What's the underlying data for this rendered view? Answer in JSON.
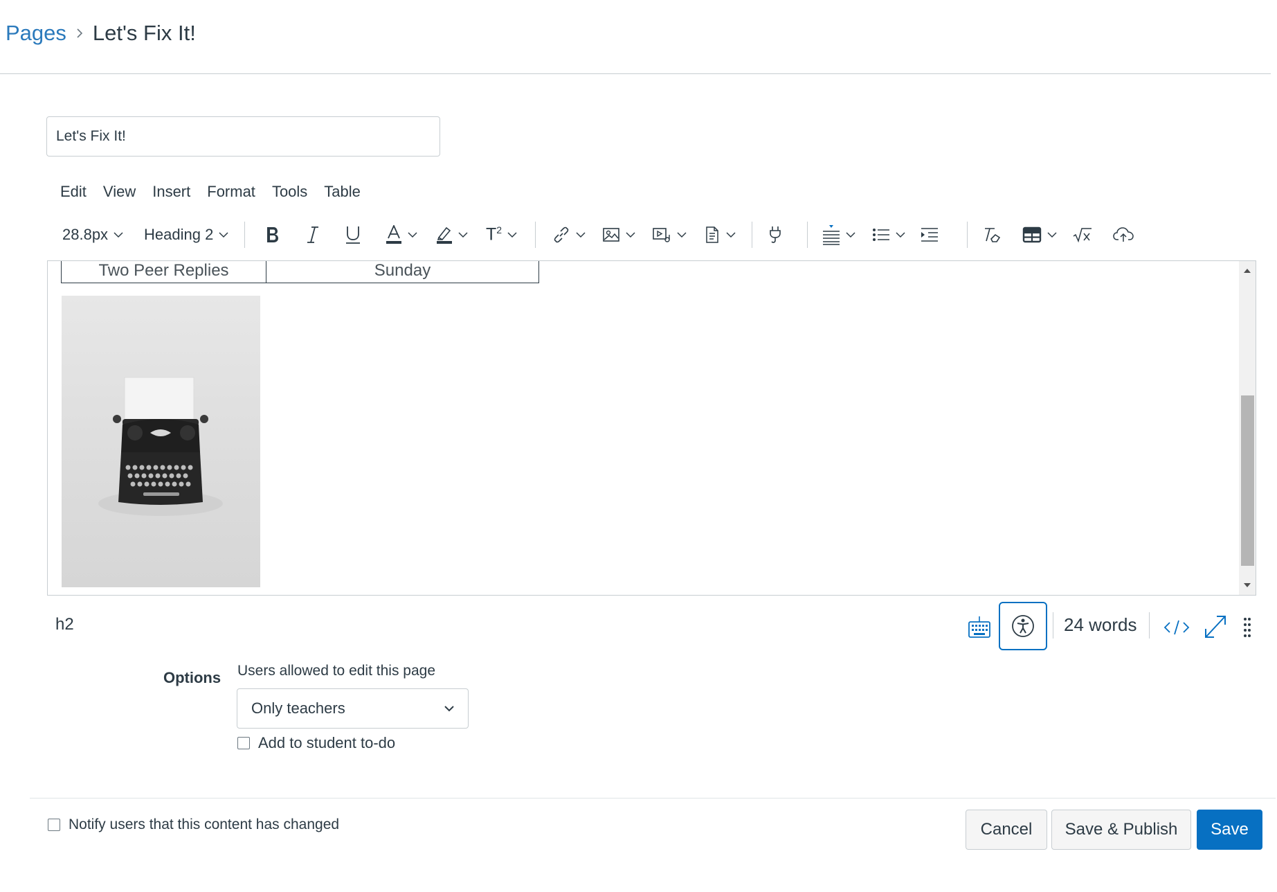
{
  "breadcrumb": {
    "parent": "Pages",
    "current": "Let's Fix It!"
  },
  "title_input": {
    "value": "Let's Fix It!"
  },
  "menubar": [
    "Edit",
    "View",
    "Insert",
    "Format",
    "Tools",
    "Table"
  ],
  "toolbar": {
    "font_size": "28.8px",
    "block_format": "Heading 2",
    "superscript_glyph": "T",
    "superscript_sup": "2"
  },
  "editor_content": {
    "table_row": [
      "Two Peer Replies",
      "Sunday"
    ],
    "image_subject": "typewriter"
  },
  "statusbar": {
    "element_path": "h2",
    "word_count": "24 words"
  },
  "options": {
    "label": "Options",
    "edit_permission_label": "Users allowed to edit this page",
    "edit_permission_value": "Only teachers",
    "todo_label": "Add to student to-do",
    "todo_checked": false
  },
  "footer": {
    "notify_label": "Notify users that this content has changed",
    "notify_checked": false,
    "cancel_label": "Cancel",
    "save_publish_label": "Save & Publish",
    "save_label": "Save"
  },
  "colors": {
    "link": "#2b7abc",
    "primary": "#0770c2",
    "text": "#2d3b45",
    "border": "#c7cdd1"
  }
}
